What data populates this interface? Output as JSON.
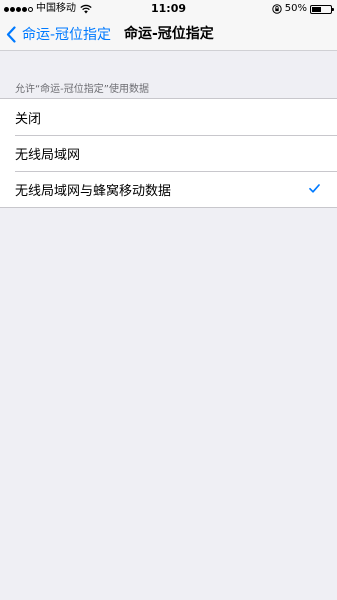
{
  "status_bar": {
    "carrier": "中国移动",
    "time": "11:09",
    "battery_percent": "50%",
    "battery_level": 0.5,
    "signal_strength": 4
  },
  "nav": {
    "back_label": "命运-冠位指定",
    "title": "命运-冠位指定"
  },
  "section": {
    "header": "允许“命运-冠位指定”使用数据"
  },
  "options": [
    {
      "label": "关闭",
      "selected": false
    },
    {
      "label": "无线局域网",
      "selected": false
    },
    {
      "label": "无线局域网与蜂窝移动数据",
      "selected": true
    }
  ],
  "colors": {
    "accent": "#007aff",
    "background": "#efeff4"
  }
}
